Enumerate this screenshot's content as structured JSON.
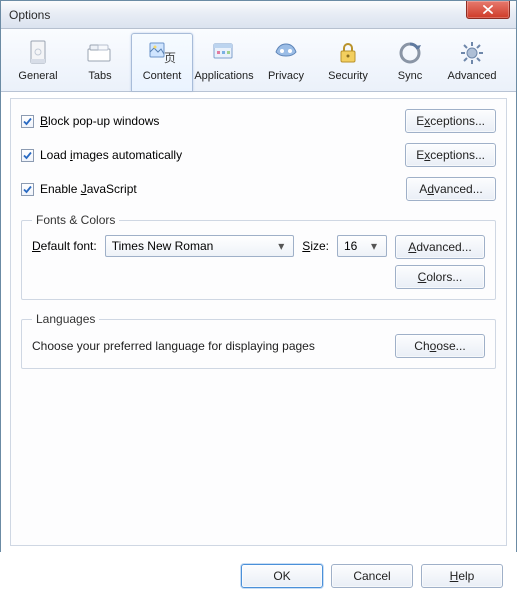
{
  "window": {
    "title": "Options"
  },
  "tabs": [
    {
      "id": "general",
      "label": "General"
    },
    {
      "id": "tabs",
      "label": "Tabs"
    },
    {
      "id": "content",
      "label": "Content",
      "active": true
    },
    {
      "id": "applications",
      "label": "Applications"
    },
    {
      "id": "privacy",
      "label": "Privacy"
    },
    {
      "id": "security",
      "label": "Security"
    },
    {
      "id": "sync",
      "label": "Sync"
    },
    {
      "id": "advanced",
      "label": "Advanced"
    }
  ],
  "content": {
    "block_popups": {
      "checked": true,
      "pre": "",
      "mn": "B",
      "post": "lock pop-up windows",
      "btn_pre": "E",
      "btn_mn": "x",
      "btn_post": "ceptions..."
    },
    "load_images": {
      "checked": true,
      "pre": "Load ",
      "mn": "i",
      "post": "mages automatically",
      "btn_pre": "E",
      "btn_mn": "x",
      "btn_post": "ceptions..."
    },
    "enable_js": {
      "checked": true,
      "pre": "Enable ",
      "mn": "J",
      "post": "avaScript",
      "btn_pre": "A",
      "btn_mn": "d",
      "btn_post": "vanced..."
    }
  },
  "fonts": {
    "legend": "Fonts & Colors",
    "default_font_pre": "",
    "default_font_mn": "D",
    "default_font_post": "efault font:",
    "font_value": "Times New Roman",
    "size_pre": "",
    "size_mn": "S",
    "size_post": "ize:",
    "size_value": "16",
    "advanced_pre": "",
    "advanced_mn": "A",
    "advanced_post": "dvanced...",
    "colors_pre": "",
    "colors_mn": "C",
    "colors_post": "olors..."
  },
  "languages": {
    "legend": "Languages",
    "text": "Choose your preferred language for displaying pages",
    "choose_pre": "Ch",
    "choose_mn": "o",
    "choose_post": "ose..."
  },
  "footer": {
    "ok": "OK",
    "cancel": "Cancel",
    "help_pre": "",
    "help_mn": "H",
    "help_post": "elp"
  }
}
